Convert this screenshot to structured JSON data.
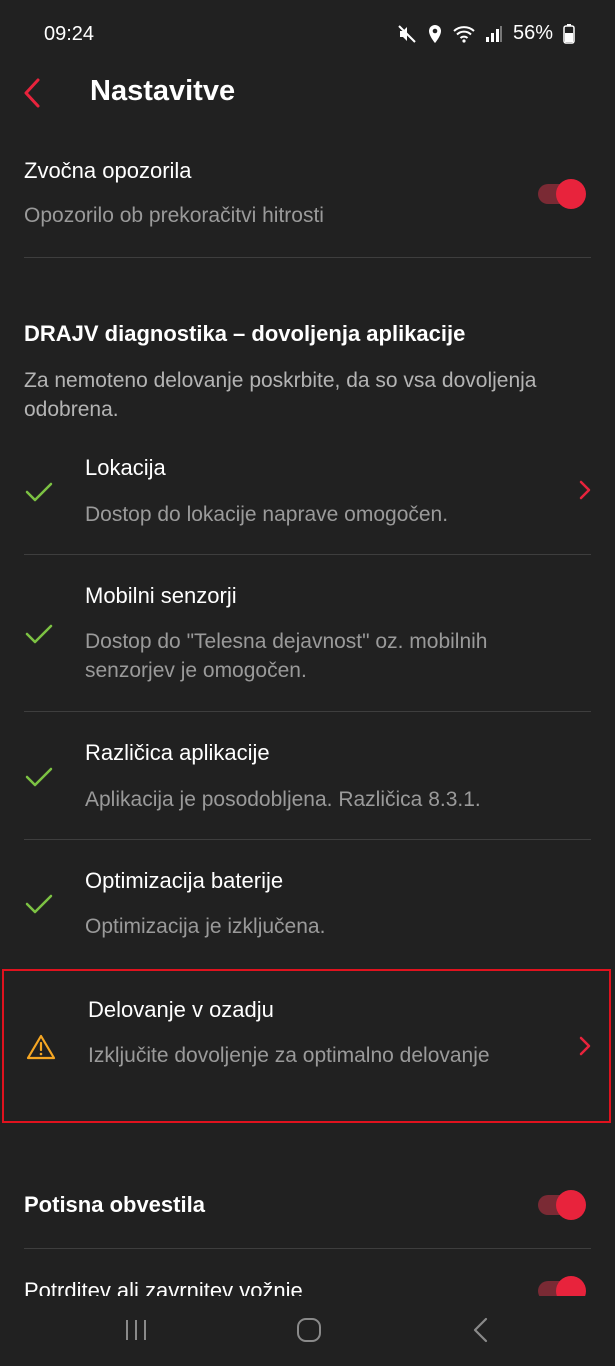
{
  "status_bar": {
    "time": "09:24",
    "battery": "56%"
  },
  "header": {
    "title": "Nastavitve"
  },
  "sound_alerts": {
    "title": "Zvočna opozorila",
    "subtitle": "Opozorilo ob prekoračitvi hitrosti",
    "enabled": true
  },
  "diagnostics": {
    "title": "DRAJV diagnostika – dovoljenja aplikacije",
    "description": "Za nemoteno delovanje poskrbite, da so vsa dovoljenja odobrena.",
    "items": [
      {
        "title": "Lokacija",
        "subtitle": "Dostop do lokacije naprave omogočen.",
        "status": "ok"
      },
      {
        "title": "Mobilni senzorji",
        "subtitle": "Dostop do \"Telesna dejavnost\" oz. mobilnih senzorjev je omogočen.",
        "status": "ok"
      },
      {
        "title": "Različica aplikacije",
        "subtitle": "Aplikacija je posodobljena. Različica 8.3.1.",
        "status": "ok"
      },
      {
        "title": "Optimizacija baterije",
        "subtitle": "Optimizacija je izključena.",
        "status": "ok"
      },
      {
        "title": "Delovanje v ozadju",
        "subtitle": "Izključite dovoljenje za optimalno delovanje",
        "status": "warning"
      }
    ]
  },
  "push_notifications": {
    "title": "Potisna obvestila",
    "enabled": true
  },
  "trip_confirm": {
    "title": "Potrditev ali zavrnitev vožnje",
    "enabled": true
  },
  "colors": {
    "accent": "#e8233c",
    "check": "#7cc243",
    "warning": "#f5a623",
    "background": "#212121"
  }
}
